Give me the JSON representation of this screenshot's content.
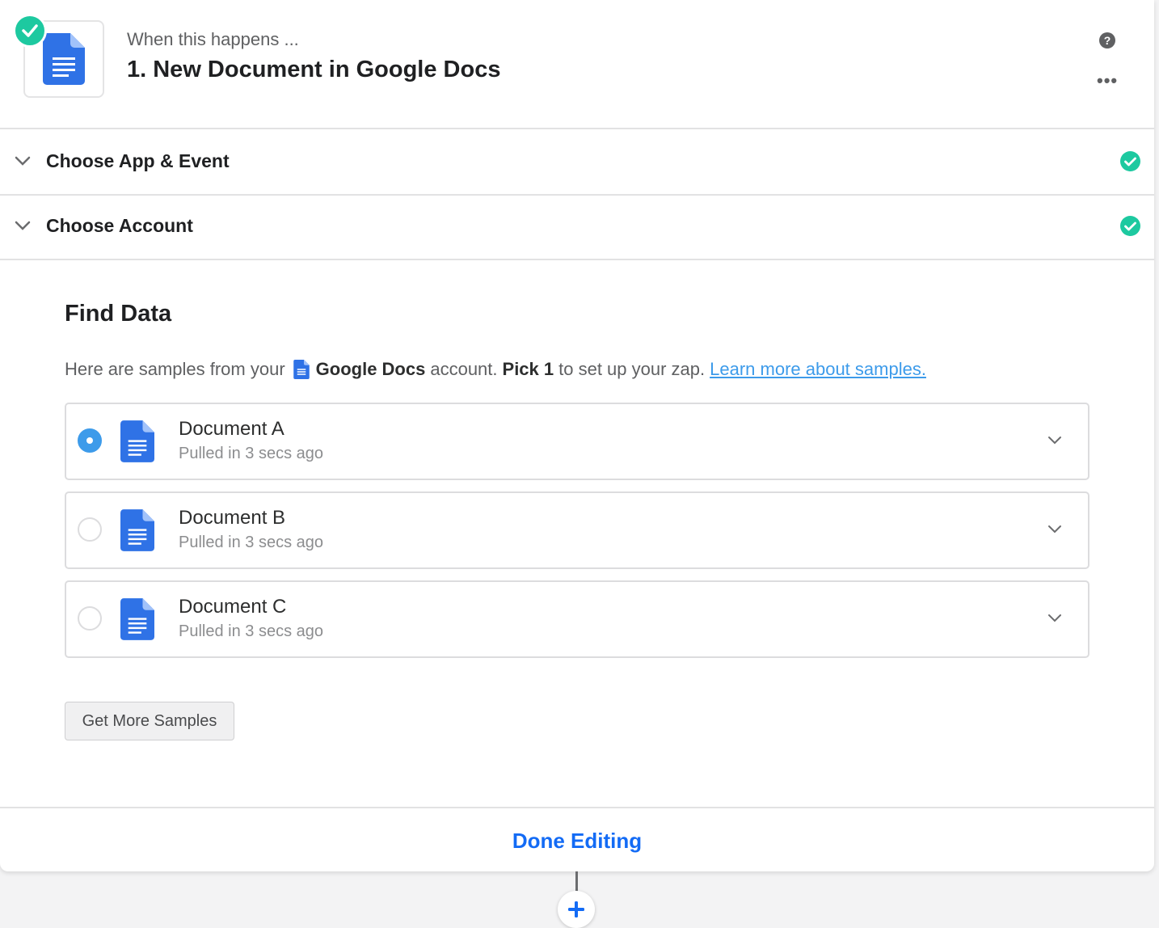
{
  "header": {
    "step_label": "When this happens ...",
    "step_title": "1. New Document in Google Docs",
    "help_glyph": "?",
    "more_glyph": "•••",
    "app_icon": "google-docs-icon",
    "status_icon": "check-icon"
  },
  "sections": [
    {
      "label": "Choose App & Event",
      "status_icon": "check-circle-icon"
    },
    {
      "label": "Choose Account",
      "status_icon": "check-circle-icon"
    }
  ],
  "find_data": {
    "title": "Find Data",
    "intro_prefix": "Here are samples from your",
    "intro_app": "Google Docs",
    "intro_mid": "account.",
    "intro_pick": "Pick 1",
    "intro_suffix": "to set up your zap.",
    "learn_more": "Learn more about samples.",
    "samples": [
      {
        "name": "Document A",
        "meta": "Pulled in 3 secs ago",
        "selected": true
      },
      {
        "name": "Document B",
        "meta": "Pulled in 3 secs ago",
        "selected": false
      },
      {
        "name": "Document C",
        "meta": "Pulled in 3 secs ago",
        "selected": false
      }
    ],
    "more_button": "Get More Samples"
  },
  "footer": {
    "done_button": "Done Editing"
  },
  "add_step_glyph": "+",
  "colors": {
    "accent_green": "#1dc9a0",
    "link_blue": "#3d9bea",
    "primary_blue": "#136bf5",
    "docs_blue": "#2f72e6"
  }
}
